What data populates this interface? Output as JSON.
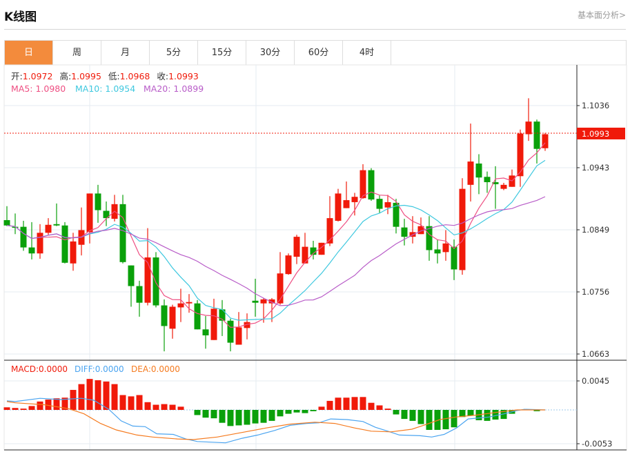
{
  "header": {
    "title": "K线图",
    "more_link": "基本面分析>"
  },
  "tabs": [
    "日",
    "周",
    "月",
    "5分",
    "15分",
    "30分",
    "60分",
    "4时"
  ],
  "active_tab": 0,
  "ohlc_legend": {
    "open_label": "开:",
    "open": "1.0972",
    "high_label": "高:",
    "high": "1.0995",
    "low_label": "低:",
    "low": "1.0968",
    "close_label": "收:",
    "close": "1.0993"
  },
  "ma_legend": {
    "ma5": "MA5: 1.0980",
    "ma10": "MA10: 1.0954",
    "ma20": "MA20: 1.0899"
  },
  "macd_legend": {
    "macd": "MACD:0.0000",
    "diff": "DIFF:0.0000",
    "dea": "DEA:0.0000"
  },
  "colors": {
    "up": "#f01a0a",
    "down": "#0aa00a",
    "ma5": "#ee4e82",
    "ma10": "#3ec8df",
    "ma20": "#b85cc8",
    "diff": "#4aa4f0",
    "dea": "#f57a1e",
    "tab_active": "#f38b3c"
  },
  "chart_data": {
    "type": "candlestick",
    "price_axis": {
      "ticks": [
        "1.1036",
        "1.0943",
        "1.0849",
        "1.0756",
        "1.0663"
      ],
      "range": [
        1.0663,
        1.1036
      ]
    },
    "current_price": "1.0993",
    "candles": [
      [
        1.0864,
        1.0885,
        1.0855,
        1.0856
      ],
      [
        1.0854,
        1.0874,
        1.0843,
        1.0853
      ],
      [
        1.0854,
        1.0863,
        1.0818,
        1.0823
      ],
      [
        1.0823,
        1.0861,
        1.0805,
        1.0814
      ],
      [
        1.0814,
        1.0858,
        1.0806,
        1.0845
      ],
      [
        1.0845,
        1.0867,
        1.0841,
        1.0857
      ],
      [
        1.0858,
        1.0889,
        1.0855,
        1.0856
      ],
      [
        1.0856,
        1.0861,
        1.0799,
        1.08
      ],
      [
        1.0799,
        1.0845,
        1.0788,
        1.0832
      ],
      [
        1.0827,
        1.0883,
        1.0811,
        1.0849
      ],
      [
        1.0846,
        1.0904,
        1.0829,
        1.0904
      ],
      [
        1.0904,
        1.0917,
        1.086,
        1.0879
      ],
      [
        1.0878,
        1.0892,
        1.0855,
        1.0867
      ],
      [
        1.0866,
        1.0902,
        1.0862,
        1.0888
      ],
      [
        1.0888,
        1.0902,
        1.0799,
        1.0801
      ],
      [
        1.0796,
        1.0796,
        1.0734,
        1.0765
      ],
      [
        1.0765,
        1.0773,
        1.0719,
        1.074
      ],
      [
        1.074,
        1.0852,
        1.0736,
        1.0808
      ],
      [
        1.0808,
        1.0816,
        1.0733,
        1.0736
      ],
      [
        1.0736,
        1.0745,
        1.0667,
        1.0705
      ],
      [
        1.0701,
        1.0737,
        1.0686,
        1.0734
      ],
      [
        1.0733,
        1.0761,
        1.0711,
        1.0739
      ],
      [
        1.0739,
        1.0753,
        1.0725,
        1.0741
      ],
      [
        1.0739,
        1.0744,
        1.07,
        1.07
      ],
      [
        1.07,
        1.072,
        1.0671,
        1.0691
      ],
      [
        1.0684,
        1.0746,
        1.0684,
        1.0731
      ],
      [
        1.073,
        1.0744,
        1.069,
        1.0713
      ],
      [
        1.0713,
        1.0716,
        1.0667,
        1.068
      ],
      [
        1.0677,
        1.0726,
        1.0677,
        1.0703
      ],
      [
        1.0702,
        1.0724,
        1.0685,
        1.0711
      ],
      [
        1.0743,
        1.0776,
        1.0719,
        1.074
      ],
      [
        1.0739,
        1.0747,
        1.071,
        1.0745
      ],
      [
        1.0739,
        1.0747,
        1.0711,
        1.0745
      ],
      [
        1.0739,
        1.0816,
        1.0737,
        1.0784
      ],
      [
        1.0783,
        1.0814,
        1.0782,
        1.0811
      ],
      [
        1.0809,
        1.0842,
        1.0798,
        1.0839
      ],
      [
        1.0799,
        1.0845,
        1.0799,
        1.0824
      ],
      [
        1.0823,
        1.0833,
        1.0805,
        1.0812
      ],
      [
        1.0812,
        1.083,
        1.0812,
        1.083
      ],
      [
        1.0829,
        1.09,
        1.0825,
        1.0867
      ],
      [
        1.0863,
        1.0911,
        1.0862,
        1.0904
      ],
      [
        1.0882,
        1.0922,
        1.0882,
        1.0894
      ],
      [
        1.0891,
        1.0905,
        1.0871,
        1.0899
      ],
      [
        1.0897,
        1.0948,
        1.0896,
        1.0939
      ],
      [
        1.0939,
        1.0942,
        1.0893,
        1.0895
      ],
      [
        1.0896,
        1.0901,
        1.0875,
        1.0881
      ],
      [
        1.0883,
        1.0902,
        1.0873,
        1.0891
      ],
      [
        1.089,
        1.0896,
        1.0844,
        1.0854
      ],
      [
        1.0853,
        1.0866,
        1.0826,
        1.0839
      ],
      [
        1.0839,
        1.087,
        1.0829,
        1.0846
      ],
      [
        1.0843,
        1.0868,
        1.0843,
        1.0855
      ],
      [
        1.0855,
        1.087,
        1.0803,
        1.0819
      ],
      [
        1.082,
        1.0835,
        1.0799,
        1.0814
      ],
      [
        1.0816,
        1.0849,
        1.0803,
        1.0829
      ],
      [
        1.0824,
        1.0835,
        1.0774,
        1.079
      ],
      [
        1.0789,
        1.0927,
        1.0782,
        1.0911
      ],
      [
        1.0917,
        1.1009,
        1.0892,
        1.0952
      ],
      [
        1.0949,
        1.0963,
        1.0903,
        1.0928
      ],
      [
        1.0929,
        1.0937,
        1.0905,
        1.0921
      ],
      [
        1.0921,
        1.0945,
        1.0881,
        1.0918
      ],
      [
        1.0911,
        1.092,
        1.0909,
        1.0917
      ],
      [
        1.0914,
        1.094,
        1.0914,
        1.0931
      ],
      [
        1.093,
        1.1,
        1.0914,
        1.0994
      ],
      [
        1.0993,
        1.1047,
        1.0983,
        1.1012
      ],
      [
        1.1012,
        1.1015,
        1.0949,
        1.0971
      ],
      [
        1.0972,
        1.0995,
        1.0968,
        1.0993
      ]
    ],
    "macd_axis": {
      "ticks": [
        "0.0045",
        "-0.0053"
      ],
      "range": [
        -0.0053,
        0.0045
      ]
    },
    "macd_hist": [
      0.0004,
      0.0003,
      0.0002,
      0.0006,
      0.0013,
      0.0016,
      0.0018,
      0.0019,
      0.0031,
      0.004,
      0.0048,
      0.0046,
      0.0044,
      0.004,
      0.0023,
      0.0021,
      0.0023,
      0.0012,
      0.0008,
      0.0009,
      0.0008,
      0.0005,
      0.0,
      -0.0008,
      -0.0012,
      -0.0013,
      -0.002,
      -0.0025,
      -0.0024,
      -0.0023,
      -0.0021,
      -0.002,
      -0.0017,
      -0.001,
      -0.0006,
      -0.0004,
      -0.0005,
      -0.0002,
      0.0005,
      0.0014,
      0.0019,
      0.0019,
      0.002,
      0.002,
      0.0011,
      0.0007,
      0.0002,
      -0.0007,
      -0.0014,
      -0.0017,
      -0.0022,
      -0.0031,
      -0.0031,
      -0.003,
      -0.0027,
      -0.0011,
      -0.0009,
      -0.0016,
      -0.0017,
      -0.0015,
      -0.0014,
      -0.0006,
      0.0,
      0.0001,
      -0.0002,
      0.0
    ],
    "diff": [
      [
        1,
        0.0014
      ],
      [
        2,
        0.0013
      ],
      [
        5,
        0.0018
      ],
      [
        7.5,
        0.0016
      ],
      [
        10,
        0.0018
      ],
      [
        11.5,
        0.0015
      ],
      [
        13.3,
        0.0001
      ],
      [
        14.8,
        -0.0017
      ],
      [
        16.2,
        -0.0025
      ],
      [
        17.7,
        -0.0026
      ],
      [
        19.1,
        -0.0037
      ],
      [
        21.1,
        -0.0038
      ],
      [
        22.6,
        -0.0045
      ],
      [
        24,
        -0.0049
      ],
      [
        27.4,
        -0.0051
      ],
      [
        29.4,
        -0.0044
      ],
      [
        31.3,
        -0.0039
      ],
      [
        33.3,
        -0.0032
      ],
      [
        35.2,
        -0.0024
      ],
      [
        37.2,
        -0.0021
      ],
      [
        38.7,
        -0.002
      ],
      [
        40.1,
        -0.0014
      ],
      [
        42.1,
        -0.0015
      ],
      [
        44,
        -0.0018
      ],
      [
        45.5,
        -0.0027
      ],
      [
        47,
        -0.0033
      ],
      [
        48.4,
        -0.0039
      ],
      [
        50.9,
        -0.004
      ],
      [
        52.3,
        -0.0042
      ],
      [
        53.8,
        -0.0038
      ],
      [
        55.3,
        -0.0028
      ],
      [
        56.7,
        -0.0014
      ],
      [
        59.2,
        -0.0011
      ],
      [
        61.1,
        -0.0006
      ],
      [
        62.6,
        -0.0001
      ],
      [
        63.5,
        0.0001
      ],
      [
        66,
        0.0
      ]
    ],
    "dea": [
      [
        1,
        0.0013
      ],
      [
        2,
        0.0011
      ],
      [
        5.5,
        0.0008
      ],
      [
        8.4,
        0.0002
      ],
      [
        10.3,
        -0.0006
      ],
      [
        12.3,
        -0.0021
      ],
      [
        14.2,
        -0.0031
      ],
      [
        16.7,
        -0.0039
      ],
      [
        18.6,
        -0.0042
      ],
      [
        21.6,
        -0.0045
      ],
      [
        23.5,
        -0.0046
      ],
      [
        26.4,
        -0.0042
      ],
      [
        29.4,
        -0.0035
      ],
      [
        32.3,
        -0.0028
      ],
      [
        35.2,
        -0.0022
      ],
      [
        38.2,
        -0.0019
      ],
      [
        40.6,
        -0.0021
      ],
      [
        43,
        -0.0028
      ],
      [
        45,
        -0.0033
      ],
      [
        47.4,
        -0.0034
      ],
      [
        49.9,
        -0.003
      ],
      [
        51.3,
        -0.0024
      ],
      [
        53.3,
        -0.0015
      ],
      [
        55.2,
        -0.0011
      ],
      [
        57.7,
        -0.0008
      ],
      [
        60.6,
        -0.0003
      ],
      [
        62.6,
        0.0
      ],
      [
        66,
        0.0
      ]
    ]
  }
}
